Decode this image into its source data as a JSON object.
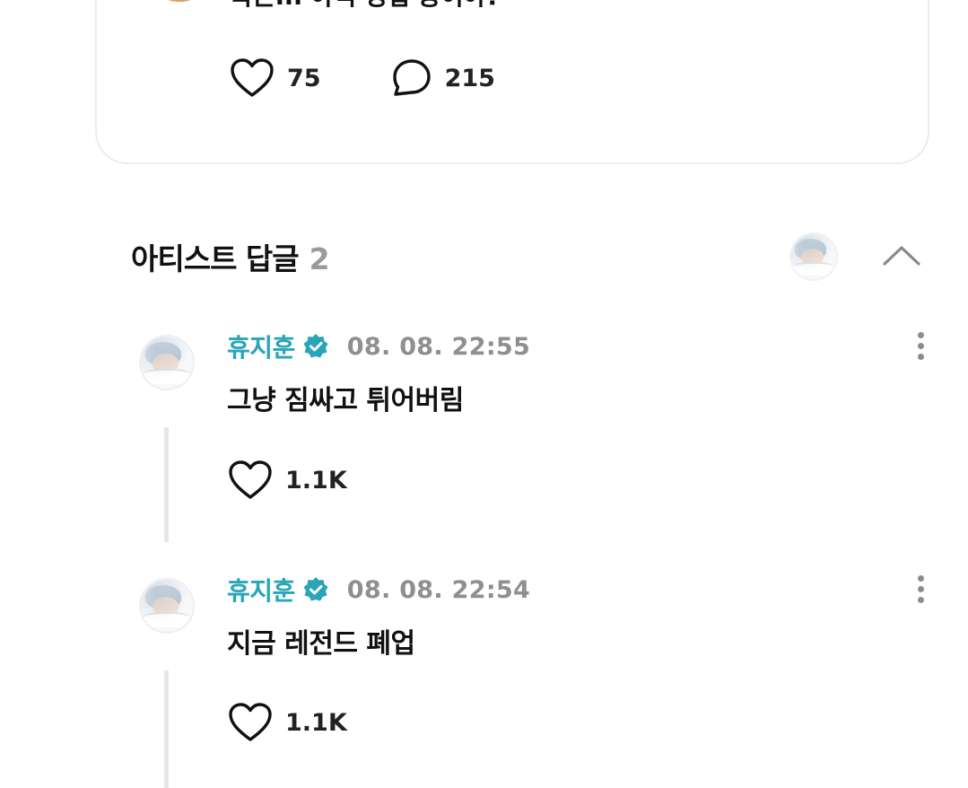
{
  "post": {
    "text": "복근... 아직 영업 중이야?",
    "likes": "75",
    "comments": "215",
    "icons": {
      "like": "heart-outline-icon",
      "comment": "speech-bubble-icon"
    }
  },
  "artist_replies": {
    "title": "아티스트 답글",
    "count": "2",
    "collapse_icon": "chevron-up-icon"
  },
  "replies": [
    {
      "author": "휴지훈",
      "verified": true,
      "time": "08. 08. 22:55",
      "text": "그냥 짐싸고 튀어버림",
      "likes": "1.1K"
    },
    {
      "author": "휴지훈",
      "verified": true,
      "time": "08. 08. 22:54",
      "text": "지금 레전드 폐업",
      "likes": "1.1K"
    }
  ],
  "colors": {
    "artist_name": "#29a5b8",
    "verified_badge": "#29a5b8",
    "muted_text": "#8f8f8f",
    "thread_line": "#e6e6e6"
  }
}
